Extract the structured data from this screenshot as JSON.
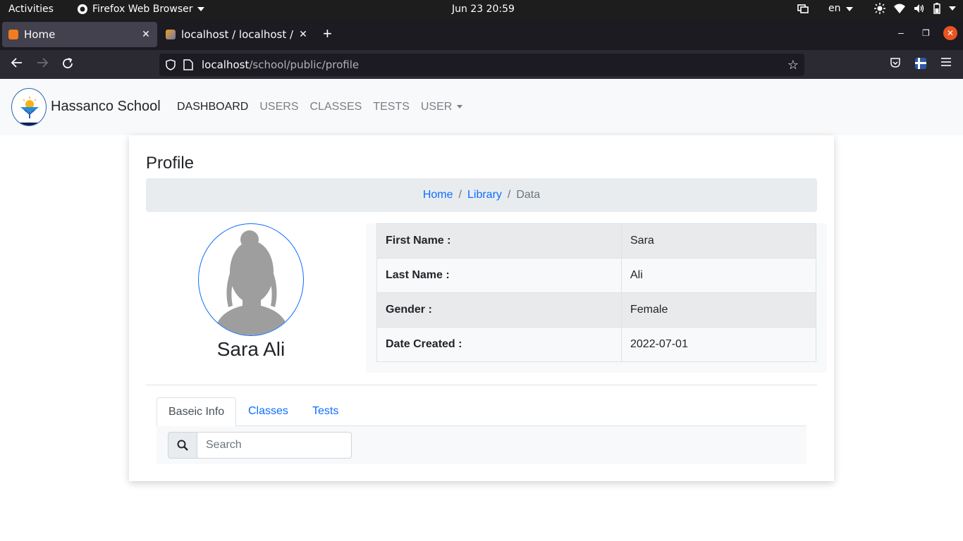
{
  "system": {
    "activities": "Activities",
    "app_menu": "Firefox Web Browser",
    "clock": "Jun 23  20:59",
    "language": "en"
  },
  "browser": {
    "tabs": [
      {
        "title": "Home",
        "active": true
      },
      {
        "title": "localhost / localhost / sch",
        "active": false
      }
    ],
    "url_host": "localhost",
    "url_path": "/school/public/profile"
  },
  "site": {
    "brand": "Hassanco School",
    "menu": [
      {
        "label": "DASHBOARD",
        "active": true
      },
      {
        "label": "USERS"
      },
      {
        "label": "CLASSES"
      },
      {
        "label": "TESTS"
      },
      {
        "label": "USER"
      }
    ]
  },
  "profile": {
    "heading": "Profile",
    "breadcrumb": [
      "Home",
      "Library",
      "Data"
    ],
    "full_name": "Sara Ali",
    "fields": [
      {
        "label": "First Name :",
        "value": "Sara"
      },
      {
        "label": "Last Name :",
        "value": "Ali"
      },
      {
        "label": "Gender :",
        "value": "Female"
      },
      {
        "label": "Date Created :",
        "value": "2022-07-01"
      }
    ],
    "tabs": [
      "Baseic Info",
      "Classes",
      "Tests"
    ],
    "search_placeholder": "Search"
  },
  "colors": {
    "link": "#0d6efd",
    "firefox_dark": "#1c1b22",
    "close_button": "#e95420"
  }
}
